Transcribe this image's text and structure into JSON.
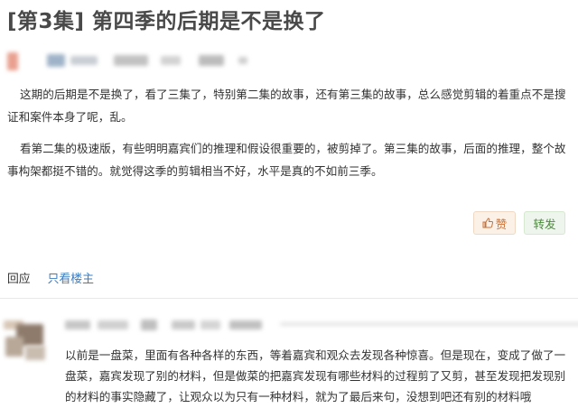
{
  "post": {
    "title": "[第3集] 第四季的后期是不是换了",
    "paragraphs": [
      "这期的后期是不是换了，看了三集了，特别第二集的故事，还有第三集的故事，总么感觉剪辑的着重点不是搜证和案件本身了呢，乱。",
      "看第二集的极速版，有些明明嘉宾们的推理和假设很重要的，被剪掉了。第三集的故事，后面的推理，整个故事构架都挺不错的。就觉得这季的剪辑相当不好，水平是真的不如前三季。"
    ]
  },
  "actions": {
    "like_label": "赞",
    "share_label": "转发",
    "like_icon": "thumbs-up-icon"
  },
  "reply_bar": {
    "reply_label": "回应",
    "only_op_label": "只看楼主"
  },
  "comment": {
    "text": "以前是一盘菜，里面有各种各样的东西，等着嘉宾和观众去发现各种惊喜。但是现在，变成了做了一盘菜，嘉宾发现了别的材料，但是做菜的把嘉宾发现有哪些材料的过程剪了又剪，甚至发现把发现别的材料的事实隐藏了，让观众以为只有一种材料，就为了最后来句，没想到吧还有别的材料哦"
  },
  "colors": {
    "link": "#3d7cbf",
    "like_text": "#c8723a",
    "share_text": "#4b8a3c"
  }
}
